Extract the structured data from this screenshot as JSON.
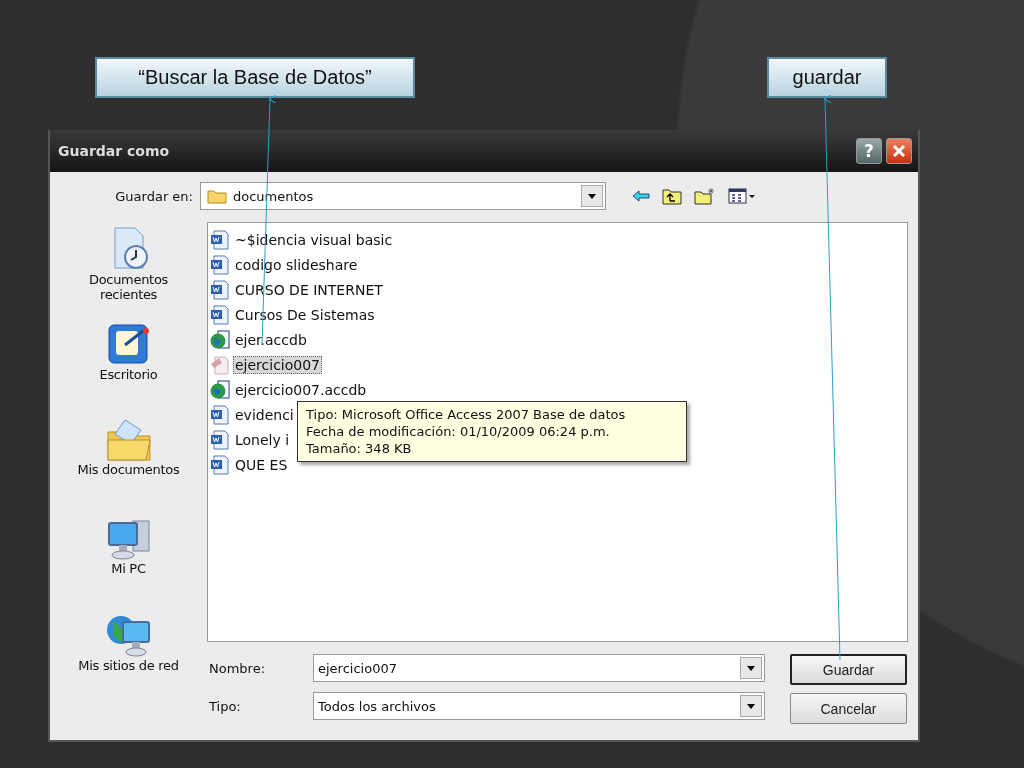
{
  "callouts": [
    {
      "text": "“Buscar la Base de Datos”"
    },
    {
      "text": "guardar"
    }
  ],
  "window": {
    "title": "Guardar como",
    "help": "?"
  },
  "save_in": {
    "label": "Guardar en:",
    "value": "documentos"
  },
  "places": [
    {
      "label": "Documentos recientes",
      "kind": "recent"
    },
    {
      "label": "Escritorio",
      "kind": "desktop"
    },
    {
      "label": "Mis documentos",
      "kind": "documents"
    },
    {
      "label": "Mi PC",
      "kind": "computer"
    },
    {
      "label": "Mis sitios de red",
      "kind": "network"
    }
  ],
  "files": [
    {
      "name": "~$idencia visual basic",
      "kind": "word",
      "selected": false
    },
    {
      "name": "codigo slideshare",
      "kind": "word",
      "selected": false
    },
    {
      "name": "CURSO DE INTERNET",
      "kind": "word",
      "selected": false
    },
    {
      "name": "Cursos De Sistemas",
      "kind": "word",
      "selected": false
    },
    {
      "name": "ejer.accdb",
      "kind": "database",
      "selected": false
    },
    {
      "name": "ejercicio007",
      "kind": "access",
      "selected": true
    },
    {
      "name": "ejercicio007.accdb",
      "kind": "database",
      "selected": false
    },
    {
      "name": "evidenci",
      "kind": "word",
      "selected": false
    },
    {
      "name": "Lonely i",
      "kind": "word",
      "selected": false
    },
    {
      "name": "QUE ES",
      "kind": "word",
      "selected": false
    }
  ],
  "tooltip": {
    "lines": [
      "Tipo: Microsoft Office Access 2007 Base de datos",
      "Fecha de modificación: 01/10/2009 06:24 p.m.",
      "Tamaño: 348 KB"
    ]
  },
  "name_field": {
    "label": "Nombre:",
    "value": "ejercicio007"
  },
  "type_field": {
    "label": "Tipo:",
    "value": "Todos los archivos"
  },
  "buttons": [
    {
      "label": "Guardar",
      "default": true
    },
    {
      "label": "Cancelar",
      "default": false
    }
  ]
}
